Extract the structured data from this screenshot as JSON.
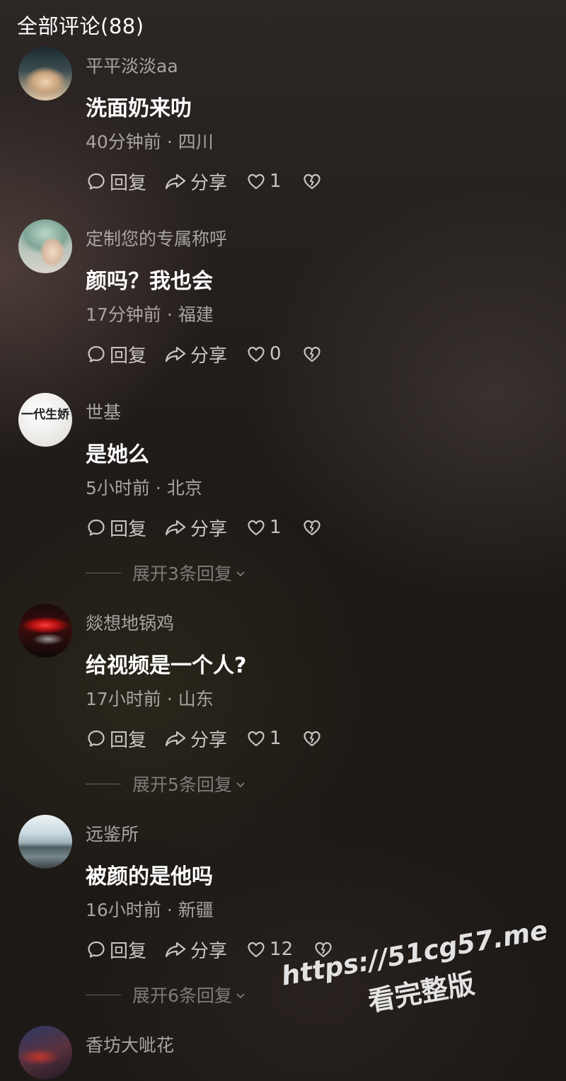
{
  "header": {
    "title": "全部评论(88)"
  },
  "labels": {
    "reply": "回复",
    "share": "分享"
  },
  "comments": [
    {
      "username": "平平淡淡aa",
      "text": "洗面奶来叻",
      "time": "40分钟前",
      "location": "四川",
      "likes": "1"
    },
    {
      "username": "定制您的专属称呼",
      "text": "颜吗？我也会",
      "time": "17分钟前",
      "location": "福建",
      "likes": "0"
    },
    {
      "username": "世基",
      "text": "是她么",
      "time": "5小时前",
      "location": "北京",
      "likes": "1",
      "expand": "展开3条回复",
      "avatar_text": "一代生娇"
    },
    {
      "username": "燚想地锅鸡",
      "text": "给视频是一个人?",
      "time": "17小时前",
      "location": "山东",
      "likes": "1",
      "expand": "展开5条回复"
    },
    {
      "username": "远鉴所",
      "text": "被颜的是他吗",
      "time": "16小时前",
      "location": "新疆",
      "likes": "12",
      "expand": "展开6条回复"
    },
    {
      "username": "香坊大呲花"
    }
  ],
  "watermark": {
    "url": "https://51cg57.me",
    "text": "看完整版"
  },
  "icons": {
    "reply": "comment-bubble-icon",
    "share": "share-arrow-icon",
    "like": "heart-icon",
    "dislike": "broken-heart-icon",
    "expand": "chevron-down-icon"
  }
}
